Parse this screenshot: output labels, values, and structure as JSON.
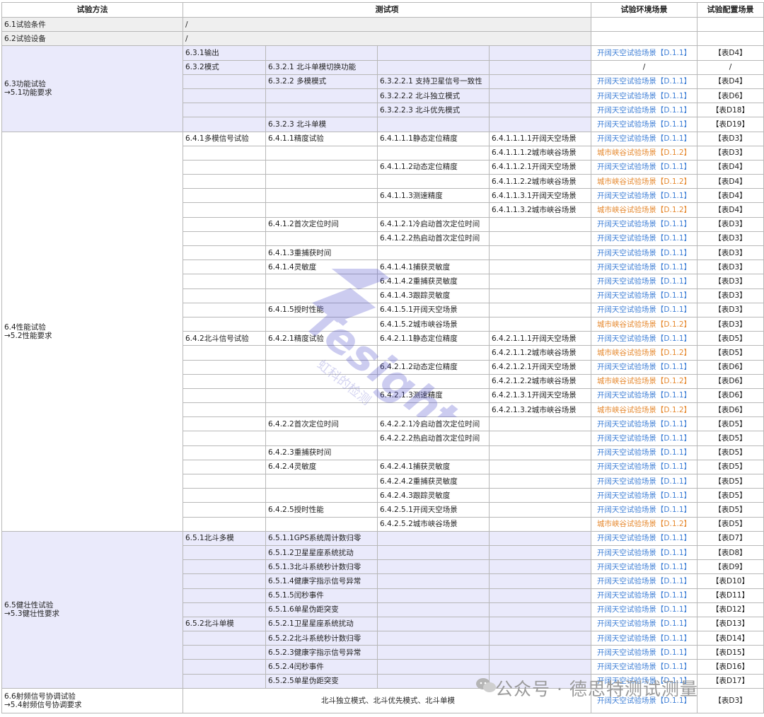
{
  "headers": {
    "method": "试验方法",
    "item": "测试项",
    "env": "试验环境场景",
    "cfg": "试验配置场景"
  },
  "r1": {
    "method": "6.1试验条件",
    "item": "/"
  },
  "r2": {
    "method": "6.2试验设备",
    "item": "/"
  },
  "s63": {
    "method_line1": "6.3功能试验",
    "method_line2": "→5.1功能要求"
  },
  "s64": {
    "method_line1": "6.4性能试验",
    "method_line2": "→5.2性能要求"
  },
  "s65": {
    "method_line1": "6.5健壮性试验",
    "method_line2": "→5.3健壮性要求"
  },
  "s66": {
    "method_line1": "6.6射频信号协调试验",
    "method_line2": "→5.4射频信号协调要求",
    "item": "北斗独立模式、北斗优先模式、北斗单模",
    "env": "开阔天空试验场景【D.1.1】",
    "cfg": "【表D3】"
  },
  "rows": [
    {
      "c1": "6.3.1输出",
      "c2": "",
      "c3": "",
      "c4": "",
      "env": "开阔天空试验场景【D.1.1】",
      "cfg": "【表D4】"
    },
    {
      "c1": "6.3.2模式",
      "c2": "6.3.2.1 北斗单模切换功能",
      "c3": "",
      "c4": "",
      "env": "/",
      "cfg": "/"
    },
    {
      "c1": "",
      "c2": "6.3.2.2 多模模式",
      "c3": "6.3.2.2.1 支持卫星信号一致性",
      "c4": "",
      "env": "开阔天空试验场景【D.1.1】",
      "cfg": "【表D4】"
    },
    {
      "c1": "",
      "c2": "",
      "c3": "6.3.2.2.2 北斗独立模式",
      "c4": "",
      "env": "开阔天空试验场景【D.1.1】",
      "cfg": "【表D6】"
    },
    {
      "c1": "",
      "c2": "",
      "c3": "6.3.2.2.3 北斗优先模式",
      "c4": "",
      "env": "开阔天空试验场景【D.1.1】",
      "cfg": "【表D18】"
    },
    {
      "c1": "",
      "c2": "6.3.2.3 北斗单模",
      "c3": "",
      "c4": "",
      "env": "开阔天空试验场景【D.1.1】",
      "cfg": "【表D19】"
    },
    {
      "c1": "6.4.1多模信号试验",
      "c2": "6.4.1.1精度试验",
      "c3": "6.4.1.1.1静态定位精度",
      "c4": "6.4.1.1.1.1开阔天空场景",
      "env": "开阔天空试验场景【D.1.1】",
      "cfg": "【表D3】"
    },
    {
      "c1": "",
      "c2": "",
      "c3": "",
      "c4": "6.4.1.1.1.2城市峡谷场景",
      "env": "城市峡谷试验场景【D.1.2】",
      "cfg": "【表D3】"
    },
    {
      "c1": "",
      "c2": "",
      "c3": "6.4.1.1.2动态定位精度",
      "c4": "6.4.1.1.2.1开阔天空场景",
      "env": "开阔天空试验场景【D.1.1】",
      "cfg": "【表D4】"
    },
    {
      "c1": "",
      "c2": "",
      "c3": "",
      "c4": "6.4.1.1.2.2城市峡谷场景",
      "env": "城市峡谷试验场景【D.1.2】",
      "cfg": "【表D4】"
    },
    {
      "c1": "",
      "c2": "",
      "c3": "6.4.1.1.3测速精度",
      "c4": "6.4.1.1.3.1开阔天空场景",
      "env": "开阔天空试验场景【D.1.1】",
      "cfg": "【表D4】"
    },
    {
      "c1": "",
      "c2": "",
      "c3": "",
      "c4": "6.4.1.1.3.2城市峡谷场景",
      "env": "城市峡谷试验场景【D.1.2】",
      "cfg": "【表D4】"
    },
    {
      "c1": "",
      "c2": "6.4.1.2首次定位时间",
      "c3": "6.4.1.2.1冷启动首次定位时间",
      "c4": "",
      "env": "开阔天空试验场景【D.1.1】",
      "cfg": "【表D3】"
    },
    {
      "c1": "",
      "c2": "",
      "c3": "6.4.1.2.2热启动首次定位时间",
      "c4": "",
      "env": "开阔天空试验场景【D.1.1】",
      "cfg": "【表D3】"
    },
    {
      "c1": "",
      "c2": "6.4.1.3重捕获时间",
      "c3": "",
      "c4": "",
      "env": "开阔天空试验场景【D.1.1】",
      "cfg": "【表D3】"
    },
    {
      "c1": "",
      "c2": "6.4.1.4灵敏度",
      "c3": "6.4.1.4.1捕获灵敏度",
      "c4": "",
      "env": "开阔天空试验场景【D.1.1】",
      "cfg": "【表D3】"
    },
    {
      "c1": "",
      "c2": "",
      "c3": "6.4.1.4.2重捕获灵敏度",
      "c4": "",
      "env": "开阔天空试验场景【D.1.1】",
      "cfg": "【表D3】"
    },
    {
      "c1": "",
      "c2": "",
      "c3": "6.4.1.4.3跟踪灵敏度",
      "c4": "",
      "env": "开阔天空试验场景【D.1.1】",
      "cfg": "【表D3】"
    },
    {
      "c1": "",
      "c2": "6.4.1.5授时性能",
      "c3": "6.4.1.5.1开阔天空场景",
      "c4": "",
      "env": "开阔天空试验场景【D.1.1】",
      "cfg": "【表D3】"
    },
    {
      "c1": "",
      "c2": "",
      "c3": "6.4.1.5.2城市峡谷场景",
      "c4": "",
      "env": "城市峡谷试验场景【D.1.2】",
      "cfg": "【表D3】"
    },
    {
      "c1": "6.4.2北斗信号试验",
      "c2": "6.4.2.1精度试验",
      "c3": "6.4.2.1.1静态定位精度",
      "c4": "6.4.2.1.1.1开阔天空场景",
      "env": "开阔天空试验场景【D.1.1】",
      "cfg": "【表D5】"
    },
    {
      "c1": "",
      "c2": "",
      "c3": "",
      "c4": "6.4.2.1.1.2城市峡谷场景",
      "env": "城市峡谷试验场景【D.1.2】",
      "cfg": "【表D5】"
    },
    {
      "c1": "",
      "c2": "",
      "c3": "6.4.2.1.2动态定位精度",
      "c4": "6.4.2.1.2.1开阔天空场景",
      "env": "开阔天空试验场景【D.1.1】",
      "cfg": "【表D6】"
    },
    {
      "c1": "",
      "c2": "",
      "c3": "",
      "c4": "6.4.2.1.2.2城市峡谷场景",
      "env": "城市峡谷试验场景【D.1.2】",
      "cfg": "【表D6】"
    },
    {
      "c1": "",
      "c2": "",
      "c3": "6.4.2.1.3测速精度",
      "c4": "6.4.2.1.3.1开阔天空场景",
      "env": "开阔天空试验场景【D.1.1】",
      "cfg": "【表D6】"
    },
    {
      "c1": "",
      "c2": "",
      "c3": "",
      "c4": "6.4.2.1.3.2城市峡谷场景",
      "env": "城市峡谷试验场景【D.1.2】",
      "cfg": "【表D6】"
    },
    {
      "c1": "",
      "c2": "6.4.2.2首次定位时间",
      "c3": "6.4.2.2.1冷启动首次定位时间",
      "c4": "",
      "env": "开阔天空试验场景【D.1.1】",
      "cfg": "【表D5】"
    },
    {
      "c1": "",
      "c2": "",
      "c3": "6.4.2.2.2热启动首次定位时间",
      "c4": "",
      "env": "开阔天空试验场景【D.1.1】",
      "cfg": "【表D5】"
    },
    {
      "c1": "",
      "c2": "6.4.2.3重捕获时间",
      "c3": "",
      "c4": "",
      "env": "开阔天空试验场景【D.1.1】",
      "cfg": "【表D5】"
    },
    {
      "c1": "",
      "c2": "6.4.2.4灵敏度",
      "c3": "6.4.2.4.1捕获灵敏度",
      "c4": "",
      "env": "开阔天空试验场景【D.1.1】",
      "cfg": "【表D5】"
    },
    {
      "c1": "",
      "c2": "",
      "c3": "6.4.2.4.2重捕获灵敏度",
      "c4": "",
      "env": "开阔天空试验场景【D.1.1】",
      "cfg": "【表D5】"
    },
    {
      "c1": "",
      "c2": "",
      "c3": "6.4.2.4.3跟踪灵敏度",
      "c4": "",
      "env": "开阔天空试验场景【D.1.1】",
      "cfg": "【表D5】"
    },
    {
      "c1": "",
      "c2": "6.4.2.5授时性能",
      "c3": "6.4.2.5.1开阔天空场景",
      "c4": "",
      "env": "开阔天空试验场景【D.1.1】",
      "cfg": "【表D5】"
    },
    {
      "c1": "",
      "c2": "",
      "c3": "6.4.2.5.2城市峡谷场景",
      "c4": "",
      "env": "城市峡谷试验场景【D.1.2】",
      "cfg": "【表D5】"
    },
    {
      "c1": "6.5.1北斗多模",
      "c2": "6.5.1.1GPS系统周计数归零",
      "c3": "",
      "c4": "",
      "env": "开阔天空试验场景【D.1.1】",
      "cfg": "【表D7】"
    },
    {
      "c1": "",
      "c2": "6.5.1.2卫星星座系统扰动",
      "c3": "",
      "c4": "",
      "env": "开阔天空试验场景【D.1.1】",
      "cfg": "【表D8】"
    },
    {
      "c1": "",
      "c2": "6.5.1.3北斗系统秒计数归零",
      "c3": "",
      "c4": "",
      "env": "开阔天空试验场景【D.1.1】",
      "cfg": "【表D9】"
    },
    {
      "c1": "",
      "c2": "6.5.1.4健康字指示信号异常",
      "c3": "",
      "c4": "",
      "env": "开阔天空试验场景【D.1.1】",
      "cfg": "【表D10】"
    },
    {
      "c1": "",
      "c2": "6.5.1.5闰秒事件",
      "c3": "",
      "c4": "",
      "env": "开阔天空试验场景【D.1.1】",
      "cfg": "【表D11】"
    },
    {
      "c1": "",
      "c2": "6.5.1.6单星伪距突变",
      "c3": "",
      "c4": "",
      "env": "开阔天空试验场景【D.1.1】",
      "cfg": "【表D12】"
    },
    {
      "c1": "6.5.2北斗单模",
      "c2": "6.5.2.1卫星星座系统扰动",
      "c3": "",
      "c4": "",
      "env": "开阔天空试验场景【D.1.1】",
      "cfg": "【表D13】"
    },
    {
      "c1": "",
      "c2": "6.5.2.2北斗系统秒计数归零",
      "c3": "",
      "c4": "",
      "env": "开阔天空试验场景【D.1.1】",
      "cfg": "【表D14】"
    },
    {
      "c1": "",
      "c2": "6.5.2.3健康字指示信号异常",
      "c3": "",
      "c4": "",
      "env": "开阔天空试验场景【D.1.1】",
      "cfg": "【表D15】"
    },
    {
      "c1": "",
      "c2": "6.5.2.4闰秒事件",
      "c3": "",
      "c4": "",
      "env": "开阔天空试验场景【D.1.1】",
      "cfg": "【表D16】"
    },
    {
      "c1": "",
      "c2": "6.5.2.5单星伪距突变",
      "c3": "",
      "c4": "",
      "env": "开阔天空试验场景【D.1.1】",
      "cfg": "【表D17】"
    }
  ],
  "watermark": {
    "logo_text": "Tesight",
    "logo_sub": "虹科的检测",
    "account": "公众号 · 德思特测试测量"
  },
  "colors": {
    "open_sky": "#3f7fd6",
    "urban_canyon": "#e6892f",
    "header_gray": "#efefef",
    "section_lavender": "#eaeafb"
  }
}
